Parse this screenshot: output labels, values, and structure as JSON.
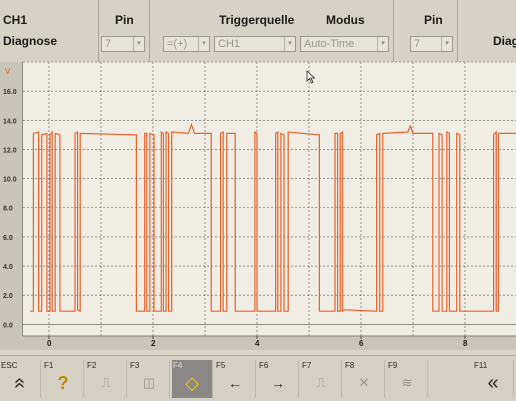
{
  "header": {
    "channel": "CH1",
    "mode_name": "Diagnose",
    "pin_label": "Pin",
    "pin_value": "7",
    "trigger_label": "Triggerquelle",
    "trigger_slope": "=(+)",
    "trigger_source": "CH1",
    "modus_label": "Modus",
    "modus_value": "Auto-Time",
    "pin2_label": "Pin",
    "pin2_value": "7",
    "right_cut_label": "Diag"
  },
  "chart_data": {
    "type": "line",
    "y_unit": "V",
    "ylim": [
      -0.8,
      18.0
    ],
    "y_ticks": [
      "0.0",
      "2.0",
      "4.0",
      "6.0",
      "8.0",
      "10.0",
      "12.0",
      "14.0",
      "16.0"
    ],
    "xlim": [
      -0.5,
      9.0
    ],
    "x_ticks": [
      "0",
      "2",
      "4",
      "6",
      "8"
    ],
    "grid": true,
    "color": "#e8622c",
    "high_level": 13.0,
    "low_level": 0.9,
    "series": [
      {
        "segments": [
          [
            -0.36,
            0.9
          ],
          [
            -0.3,
            0.9
          ],
          [
            -0.3,
            13.1
          ],
          [
            -0.2,
            13.2
          ],
          [
            -0.2,
            0.9
          ],
          [
            -0.14,
            0.9
          ],
          [
            -0.14,
            13.0
          ],
          [
            -0.04,
            13.1
          ],
          [
            -0.04,
            0.9
          ],
          [
            0.02,
            0.9
          ],
          [
            0.02,
            13.0
          ],
          [
            0.06,
            13.2
          ],
          [
            0.06,
            0.9
          ],
          [
            0.12,
            0.9
          ],
          [
            0.12,
            13.1
          ],
          [
            0.21,
            13.0
          ],
          [
            0.21,
            0.9
          ],
          [
            0.5,
            0.9
          ],
          [
            0.5,
            13.1
          ],
          [
            0.55,
            13.2
          ],
          [
            0.55,
            1.0
          ],
          [
            0.6,
            0.9
          ],
          [
            0.6,
            13.1
          ],
          [
            1.68,
            13.0
          ],
          [
            1.68,
            0.9
          ],
          [
            1.84,
            0.9
          ],
          [
            1.84,
            13.1
          ],
          [
            1.88,
            13.1
          ],
          [
            1.88,
            0.9
          ],
          [
            1.94,
            0.9
          ],
          [
            1.94,
            13.1
          ],
          [
            2.02,
            13.0
          ],
          [
            2.02,
            0.9
          ],
          [
            2.16,
            0.9
          ],
          [
            2.16,
            13.2
          ],
          [
            2.2,
            13.1
          ],
          [
            2.2,
            0.9
          ],
          [
            2.25,
            0.9
          ],
          [
            2.25,
            13.2
          ],
          [
            2.3,
            13.1
          ],
          [
            2.3,
            0.9
          ],
          [
            2.36,
            0.9
          ],
          [
            2.36,
            13.2
          ],
          [
            2.68,
            13.1
          ],
          [
            2.74,
            13.7
          ],
          [
            2.8,
            13.1
          ],
          [
            3.12,
            13.1
          ],
          [
            3.12,
            0.9
          ],
          [
            3.3,
            0.9
          ],
          [
            3.3,
            13.1
          ],
          [
            3.35,
            13.2
          ],
          [
            3.35,
            0.9
          ],
          [
            3.42,
            0.9
          ],
          [
            3.42,
            13.1
          ],
          [
            3.58,
            13.1
          ],
          [
            3.58,
            0.9
          ],
          [
            3.96,
            0.9
          ],
          [
            3.96,
            13.2
          ],
          [
            4.0,
            13.1
          ],
          [
            4.0,
            0.9
          ],
          [
            4.36,
            0.9
          ],
          [
            4.36,
            13.1
          ],
          [
            4.4,
            13.2
          ],
          [
            4.4,
            0.9
          ],
          [
            4.46,
            0.9
          ],
          [
            4.46,
            13.1
          ],
          [
            4.52,
            13.0
          ],
          [
            4.52,
            0.9
          ],
          [
            4.6,
            0.9
          ],
          [
            4.6,
            13.2
          ],
          [
            5.2,
            13.0
          ],
          [
            5.2,
            0.9
          ],
          [
            5.5,
            0.9
          ],
          [
            5.5,
            13.1
          ],
          [
            5.55,
            13.1
          ],
          [
            5.55,
            0.9
          ],
          [
            5.6,
            0.9
          ],
          [
            5.6,
            13.1
          ],
          [
            5.64,
            13.2
          ],
          [
            5.64,
            0.9
          ],
          [
            5.68,
            1.0
          ],
          [
            6.3,
            0.9
          ],
          [
            6.3,
            13.0
          ],
          [
            6.36,
            13.1
          ],
          [
            6.36,
            0.9
          ],
          [
            6.42,
            0.9
          ],
          [
            6.42,
            13.1
          ],
          [
            6.9,
            13.2
          ],
          [
            6.95,
            13.6
          ],
          [
            7.0,
            13.1
          ],
          [
            7.38,
            13.1
          ],
          [
            7.38,
            0.9
          ],
          [
            7.5,
            0.9
          ],
          [
            7.5,
            13.1
          ],
          [
            7.56,
            13.0
          ],
          [
            7.56,
            0.9
          ],
          [
            7.65,
            0.9
          ],
          [
            7.65,
            13.2
          ],
          [
            7.7,
            13.1
          ],
          [
            7.7,
            0.9
          ],
          [
            7.84,
            0.9
          ],
          [
            7.84,
            13.1
          ],
          [
            7.9,
            13.0
          ],
          [
            7.9,
            0.9
          ],
          [
            8.55,
            0.9
          ],
          [
            8.55,
            13.0
          ],
          [
            8.6,
            13.2
          ],
          [
            8.6,
            0.9
          ],
          [
            8.64,
            0.9
          ],
          [
            8.64,
            13.1
          ],
          [
            9.0,
            13.1
          ]
        ]
      }
    ]
  },
  "footer": {
    "keys": [
      {
        "label": "ESC",
        "icon": "double-up-icon",
        "glyph": "«"
      },
      {
        "label": "F1",
        "icon": "help-icon",
        "glyph": "?"
      },
      {
        "label": "F2",
        "icon": "trigger-edge-icon",
        "glyph": "⎍"
      },
      {
        "label": "F3",
        "icon": "camera-icon",
        "glyph": "◫"
      },
      {
        "label": "F4",
        "icon": "diamond-icon",
        "glyph": "◆"
      },
      {
        "label": "F5",
        "icon": "arrow-left-icon",
        "glyph": "←"
      },
      {
        "label": "F6",
        "icon": "arrow-right-icon",
        "glyph": "→"
      },
      {
        "label": "F7",
        "icon": "edge-step-icon",
        "glyph": "⎍"
      },
      {
        "label": "F8",
        "icon": "cursor-x-icon",
        "glyph": "✕"
      },
      {
        "label": "F9",
        "icon": "compare-icon",
        "glyph": "≋"
      },
      {
        "label": "F11",
        "icon": "double-left-icon",
        "glyph": "«"
      }
    ]
  }
}
